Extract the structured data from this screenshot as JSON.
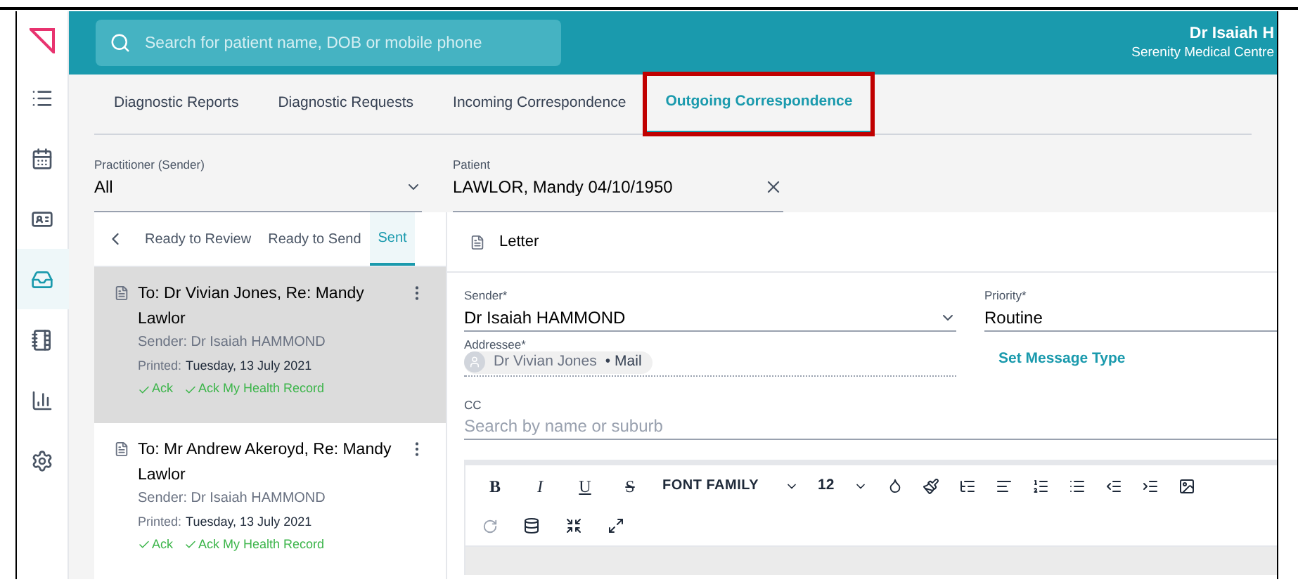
{
  "sidebar": {
    "items": [
      {
        "kind": "list",
        "selected": false
      },
      {
        "kind": "calendar",
        "selected": false
      },
      {
        "kind": "card",
        "selected": false
      },
      {
        "kind": "inbox",
        "selected": true
      },
      {
        "kind": "book",
        "selected": false
      },
      {
        "kind": "chart",
        "selected": false
      },
      {
        "kind": "settings",
        "selected": false
      }
    ]
  },
  "header": {
    "search_placeholder": "Search for patient name, DOB or mobile phone",
    "user_name": "Dr Isaiah H",
    "practice": "Serenity Medical Centre"
  },
  "tabs": [
    {
      "label": "Diagnostic Reports",
      "selected": false,
      "highlighted": false
    },
    {
      "label": "Diagnostic Requests",
      "selected": false,
      "highlighted": false
    },
    {
      "label": "Incoming Correspondence",
      "selected": false,
      "highlighted": false
    },
    {
      "label": "Outgoing Correspondence",
      "selected": true,
      "highlighted": true
    }
  ],
  "filters": {
    "practitioner": {
      "label": "Practitioner (Sender)",
      "value": "All"
    },
    "patient": {
      "label": "Patient",
      "value": "LAWLOR, Mandy 04/10/1950"
    }
  },
  "list_tabs": [
    {
      "label": "Ready to Review",
      "selected": false
    },
    {
      "label": "Ready to Send",
      "selected": false
    },
    {
      "label": "Sent",
      "selected": true
    }
  ],
  "messages": [
    {
      "title": "To: Dr Vivian Jones, Re: Mandy Lawlor",
      "sender": "Sender: Dr Isaiah HAMMOND",
      "printed_label": "Printed:",
      "printed_date": "Tuesday, 13 July 2021",
      "acks": [
        "Ack",
        "Ack My Health Record"
      ],
      "selected": true
    },
    {
      "title": "To: Mr Andrew Akeroyd, Re: Mandy Lawlor",
      "sender": "Sender: Dr Isaiah HAMMOND",
      "printed_label": "Printed:",
      "printed_date": "Tuesday, 13 July 2021",
      "acks": [
        "Ack",
        "Ack My Health Record"
      ],
      "selected": false
    }
  ],
  "detail": {
    "doc_type": "Letter",
    "sender": {
      "label": "Sender*",
      "value": "Dr Isaiah HAMMOND"
    },
    "priority": {
      "label": "Priority*",
      "value": "Routine"
    },
    "addressee": {
      "label": "Addressee*",
      "name": "Dr Vivian Jones",
      "separator": "•",
      "channel": "Mail"
    },
    "message_type_link": "Set Message Type",
    "cc": {
      "label": "CC",
      "placeholder": "Search by name or suburb"
    },
    "toolbar": {
      "format_buttons": [
        "B",
        "I",
        "U",
        "S"
      ],
      "font_family": "FONT FAMILY",
      "font_size": "12"
    }
  }
}
